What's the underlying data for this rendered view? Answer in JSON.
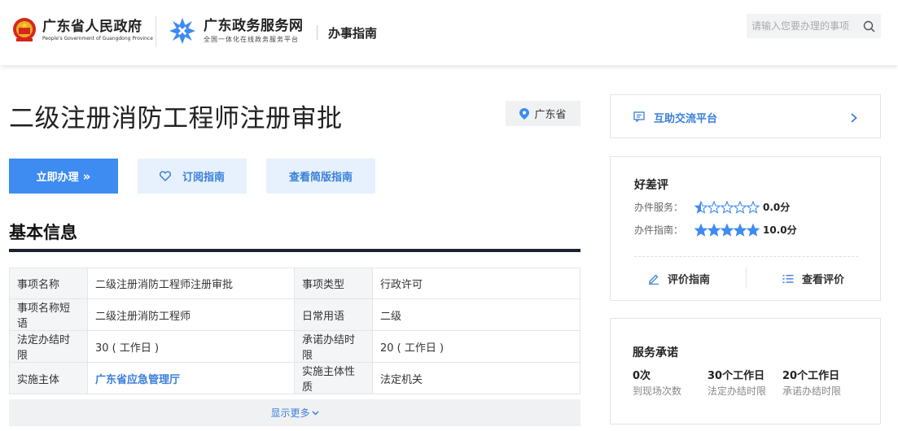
{
  "header": {
    "gov_name": "广东省人民政府",
    "gov_name_en": "People's Government of Guangdong Province",
    "portal_name": "广东政务服务网",
    "portal_tagline": "全国一体化在线政务服务平台",
    "nav_guide": "办事指南",
    "search_placeholder": "请输入您要办理的事项"
  },
  "item": {
    "title": "二级注册消防工程师注册审批",
    "region": "广东省"
  },
  "buttons": {
    "handle": "立即办理",
    "handle_arrow": "»",
    "subscribe": "订阅指南",
    "simple": "查看简版指南"
  },
  "basic": {
    "section_title": "基本信息",
    "rows": [
      [
        "事项名称",
        "二级注册消防工程师注册审批",
        "事项类型",
        "行政许可"
      ],
      [
        "事项名称短语",
        "二级注册消防工程师",
        "日常用语",
        "二级"
      ],
      [
        "法定办结时限",
        "30 ( 工作日 )",
        "承诺办结时限",
        "20 ( 工作日 )"
      ],
      [
        "实施主体",
        "广东省应急管理厅",
        "实施主体性质",
        "法定机关"
      ]
    ],
    "show_more": "显示更多"
  },
  "help": {
    "label": "互助交流平台"
  },
  "rating": {
    "title": "好差评",
    "service_label": "办件服务：",
    "service_score": "0.0分",
    "service_stars": 0.5,
    "guide_label": "办件指南：",
    "guide_score": "10.0分",
    "guide_stars": 5,
    "rate_guide": "评价指南",
    "view_ratings": "查看评价"
  },
  "promise": {
    "title": "服务承诺",
    "items": [
      {
        "value": "0次",
        "label": "到现场次数"
      },
      {
        "value": "30个工作日",
        "label": "法定办结时限"
      },
      {
        "value": "20个工作日",
        "label": "承诺办结时限"
      }
    ]
  },
  "colors": {
    "primary": "#3e8bf1",
    "link": "#3a7fd8",
    "star": "#3e8bf1"
  }
}
